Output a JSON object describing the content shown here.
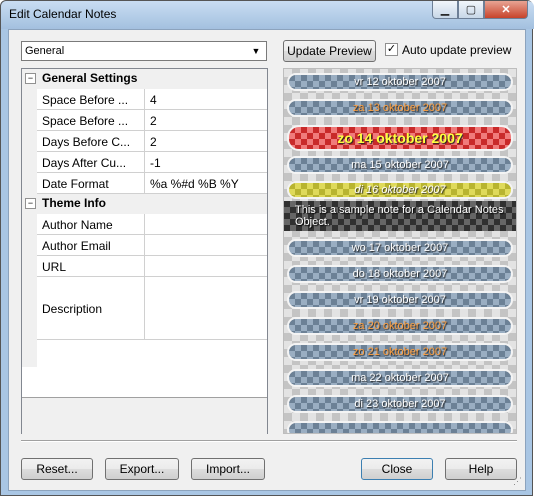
{
  "window": {
    "title": "Edit Calendar Notes"
  },
  "titlebar_buttons": {
    "minimize": "▁",
    "maximize": "▢",
    "close": "✕"
  },
  "category_select": {
    "value": "General"
  },
  "update_preview_label": "Update Preview",
  "auto_update": {
    "label": "Auto update preview",
    "checked_mark": "✓"
  },
  "grid": {
    "general_category": {
      "label": "General Settings",
      "toggle": "−"
    },
    "general_props": [
      {
        "name": "Space Before ...",
        "value": "4"
      },
      {
        "name": "Space Before ...",
        "value": "2"
      },
      {
        "name": "Days Before C...",
        "value": "2"
      },
      {
        "name": "Days After Cu...",
        "value": "-1"
      },
      {
        "name": "Date Format",
        "value": "%a %#d %B %Y"
      }
    ],
    "theme_category": {
      "label": "Theme Info",
      "toggle": "−"
    },
    "theme_props": [
      {
        "name": "Author Name",
        "value": ""
      },
      {
        "name": "Author Email",
        "value": ""
      },
      {
        "name": "URL",
        "value": ""
      },
      {
        "name": "Description",
        "value": ""
      }
    ]
  },
  "preview": {
    "days": [
      {
        "label": "vr 12 oktober 2007",
        "kind": "normal"
      },
      {
        "label": "za 13 oktober 2007",
        "kind": "weekend"
      },
      {
        "label": "zo 14 oktober 2007",
        "kind": "today"
      },
      {
        "label": "ma 15 oktober 2007",
        "kind": "normal"
      },
      {
        "label": "di 16 oktober 2007",
        "kind": "noted"
      },
      {
        "label": "wo 17 oktober 2007",
        "kind": "normal"
      },
      {
        "label": "do 18 oktober 2007",
        "kind": "normal"
      },
      {
        "label": "vr 19 oktober 2007",
        "kind": "normal"
      },
      {
        "label": "za 20 oktober 2007",
        "kind": "weekend"
      },
      {
        "label": "zo 21 oktober 2007",
        "kind": "weekend"
      },
      {
        "label": "ma 22 oktober 2007",
        "kind": "normal"
      },
      {
        "label": "di 23 oktober 2007",
        "kind": "normal"
      }
    ],
    "note_text": "This is a sample note for a Calendar Notes Object."
  },
  "buttons": {
    "reset": "Reset...",
    "export": "Export...",
    "import": "Import...",
    "close": "Close",
    "help": "Help"
  }
}
